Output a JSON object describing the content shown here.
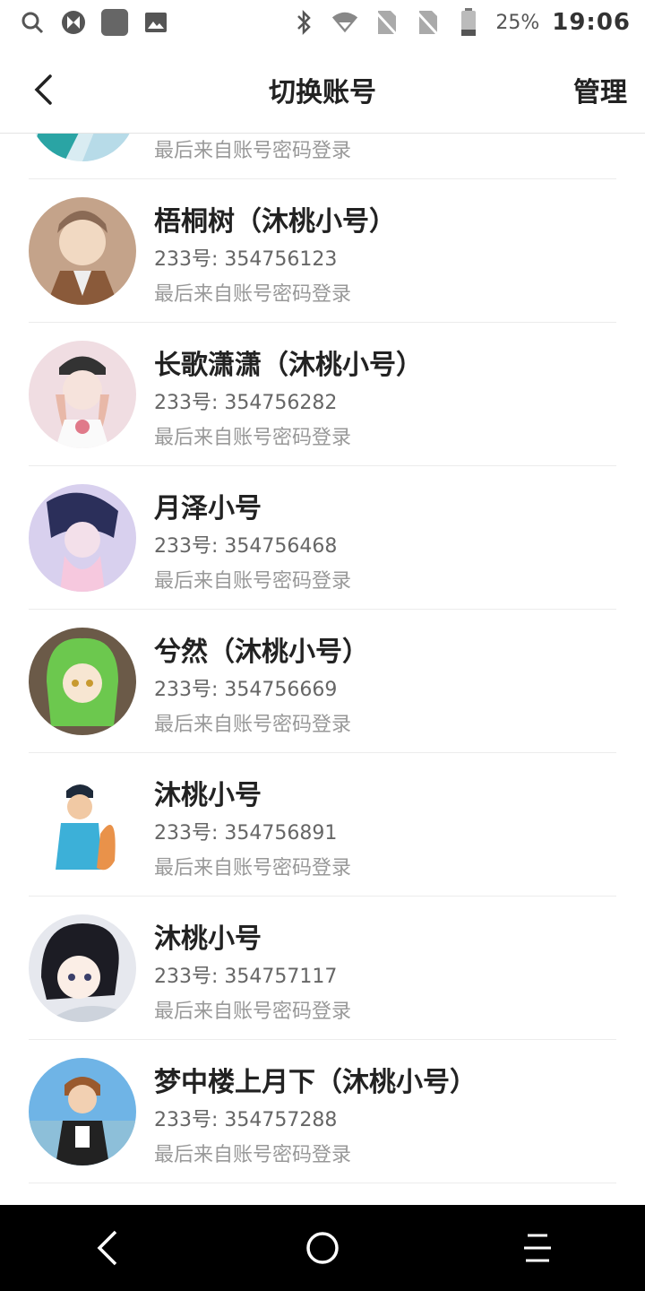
{
  "status_bar": {
    "battery_percent": "25%",
    "time": "19:06",
    "icons": [
      "search-icon",
      "app-icon",
      "square-icon",
      "image-icon",
      "bluetooth-icon",
      "wifi-icon",
      "no-sim-icon",
      "no-sim-icon",
      "battery-icon"
    ]
  },
  "header": {
    "title": "切换账号",
    "manage_label": "管理"
  },
  "accounts": [
    {
      "name": "",
      "uid": "",
      "last_login": "最后来自账号密码登录"
    },
    {
      "name": "梧桐树（沐桃小号）",
      "uid": "233号: 354756123",
      "last_login": "最后来自账号密码登录"
    },
    {
      "name": "长歌潇潇（沐桃小号）",
      "uid": "233号: 354756282",
      "last_login": "最后来自账号密码登录"
    },
    {
      "name": "月泽小号",
      "uid": "233号: 354756468",
      "last_login": "最后来自账号密码登录"
    },
    {
      "name": "兮然（沐桃小号）",
      "uid": "233号: 354756669",
      "last_login": "最后来自账号密码登录"
    },
    {
      "name": "沐桃小号",
      "uid": "233号: 354756891",
      "last_login": "最后来自账号密码登录"
    },
    {
      "name": "沐桃小号",
      "uid": "233号: 354757117",
      "last_login": "最后来自账号密码登录"
    },
    {
      "name": "梦中楼上月下（沐桃小号）",
      "uid": "233号: 354757288",
      "last_login": "最后来自账号密码登录"
    }
  ]
}
